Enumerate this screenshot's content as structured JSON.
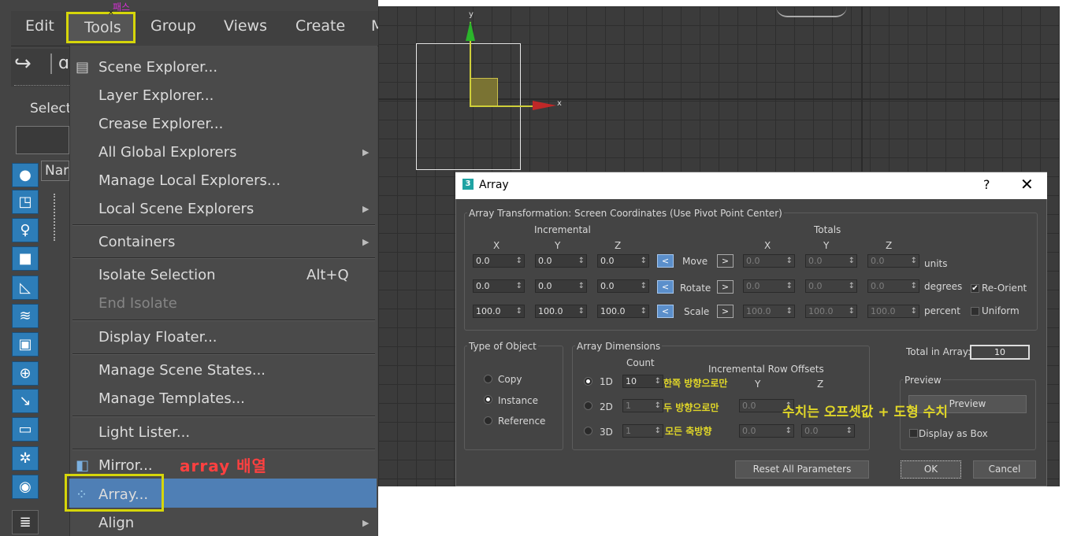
{
  "menubar": {
    "items": [
      "Edit",
      "Tools",
      "Group",
      "Views",
      "Create",
      "M"
    ],
    "tools_annotation": "패스"
  },
  "left_panel": {
    "select_label": "Select",
    "name_label": "Nar"
  },
  "tools_menu": {
    "items": [
      {
        "label": "Scene Explorer...",
        "icon": "table-icon"
      },
      {
        "label": "Layer Explorer..."
      },
      {
        "label": "Crease Explorer..."
      },
      {
        "label": "All Global Explorers",
        "submenu": true
      },
      {
        "label": "Manage Local Explorers..."
      },
      {
        "label": "Local Scene Explorers",
        "submenu": true
      },
      {
        "label": "Containers",
        "submenu": true
      },
      {
        "label": "Isolate Selection",
        "shortcut": "Alt+Q"
      },
      {
        "label": "End Isolate",
        "disabled": true
      },
      {
        "label": "Display Floater..."
      },
      {
        "label": "Manage Scene States..."
      },
      {
        "label": "Manage Templates..."
      },
      {
        "label": "Light Lister..."
      },
      {
        "label": "Mirror...",
        "icon": "mirror-icon"
      },
      {
        "label": "Array...",
        "icon": "array-icon",
        "highlighted": true
      },
      {
        "label": "Align",
        "submenu": true
      }
    ],
    "array_annotation": "array 배열"
  },
  "viewport": {
    "axis_y": "y",
    "axis_x": "x"
  },
  "array_dialog": {
    "title": "Array",
    "help": "?",
    "close": "✕",
    "transformation_group": "Array Transformation: Screen Coordinates (Use Pivot Point Center)",
    "incremental_header": "Incremental",
    "totals_header": "Totals",
    "axis_x": "X",
    "axis_y": "Y",
    "axis_z": "Z",
    "rows": [
      {
        "label": "Move",
        "inc": [
          "0.0",
          "0.0",
          "0.0"
        ],
        "tot": [
          "0.0",
          "0.0",
          "0.0"
        ],
        "unit": "units"
      },
      {
        "label": "Rotate",
        "inc": [
          "0.0",
          "0.0",
          "0.0"
        ],
        "tot": [
          "0.0",
          "0.0",
          "0.0"
        ],
        "unit": "degrees"
      },
      {
        "label": "Scale",
        "inc": [
          "100.0",
          "100.0",
          "100.0"
        ],
        "tot": [
          "100.0",
          "100.0",
          "100.0"
        ],
        "unit": "percent"
      }
    ],
    "left_arrow": "<",
    "right_arrow": ">",
    "re_orient": "Re-Orient",
    "uniform": "Uniform",
    "type_group": "Type of Object",
    "type_options": [
      "Copy",
      "Instance",
      "Reference"
    ],
    "type_selected": "Instance",
    "dimensions_group": "Array Dimensions",
    "count_header": "Count",
    "row_offset_header": "Incremental Row Offsets",
    "offset_y": "Y",
    "offset_z": "Z",
    "dims": [
      {
        "label": "1D",
        "count": "10",
        "selected": true
      },
      {
        "label": "2D",
        "count": "1",
        "offset": "0.0"
      },
      {
        "label": "3D",
        "count": "1",
        "offset": [
          "0.0",
          "0.0",
          "0.0"
        ]
      }
    ],
    "dims_notes": [
      "한쪽 방향으로만",
      "두 방향으로만",
      "모든 축방향"
    ],
    "total_label": "Total in Array:",
    "total_value": "10",
    "preview_group": "Preview",
    "preview_button": "Preview",
    "display_as_box": "Display as Box",
    "offset_note": "수치는 오프셋값 + 도형 수치",
    "reset_button": "Reset All Parameters",
    "ok_button": "OK",
    "cancel_button": "Cancel"
  }
}
